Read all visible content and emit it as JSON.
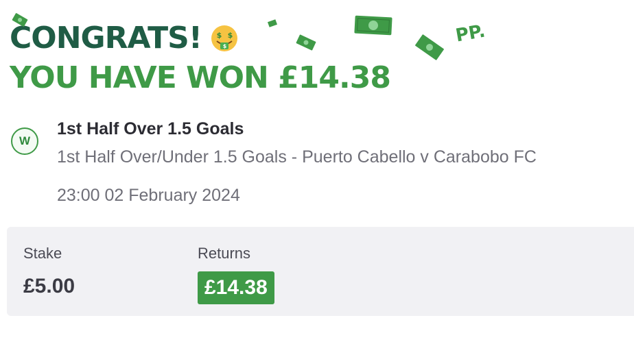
{
  "header": {
    "congrats": "CONGRATS!",
    "emoji_icon": "money-mouth-face-icon",
    "win_text": "YOU HAVE WON £14.38",
    "brand_mark": "PP."
  },
  "bet": {
    "result_badge": "W",
    "selection": "1st Half Over 1.5 Goals",
    "market": "1st Half Over/Under 1.5 Goals - Puerto Cabello v Carabobo FC",
    "datetime": "23:00 02 February 2024"
  },
  "summary": {
    "stake_label": "Stake",
    "stake_value": "£5.00",
    "returns_label": "Returns",
    "returns_value": "£14.38"
  },
  "colors": {
    "dark_green": "#1f5c45",
    "brand_green": "#3f9a47",
    "panel_bg": "#f1f1f4"
  }
}
